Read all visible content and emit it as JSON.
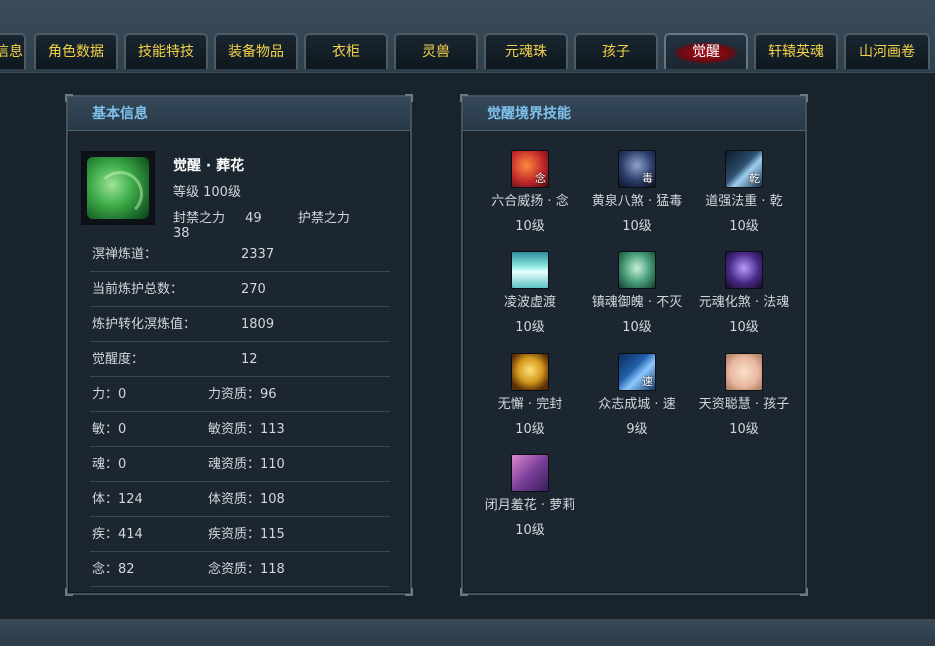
{
  "tabs": [
    {
      "label": "信息",
      "active": false
    },
    {
      "label": "角色数据",
      "active": false
    },
    {
      "label": "技能特技",
      "active": false
    },
    {
      "label": "装备物品",
      "active": false
    },
    {
      "label": "衣柜",
      "active": false
    },
    {
      "label": "灵兽",
      "active": false
    },
    {
      "label": "元魂珠",
      "active": false
    },
    {
      "label": "孩子",
      "active": false
    },
    {
      "label": "觉醒",
      "active": true
    },
    {
      "label": "轩辕英魂",
      "active": false
    },
    {
      "label": "山河画卷",
      "active": false
    }
  ],
  "basic_info": {
    "title": "基本信息",
    "name": "觉醒 · 葬花",
    "level": "等级 100级",
    "seal_label": "封禁之力",
    "seal_value": "49",
    "guard_label": "护禁之力",
    "guard_value": "38",
    "rows": [
      {
        "label": "溟禅炼道：",
        "value": "2337"
      },
      {
        "label": "当前炼护总数：",
        "value": "270"
      },
      {
        "label": "炼护转化溟炼值：",
        "value": "1809"
      },
      {
        "label": "觉醒度：",
        "value": "12"
      }
    ],
    "attrs": [
      {
        "label": "力：0",
        "qual": "力资质：96"
      },
      {
        "label": "敏：0",
        "qual": "敏资质：113"
      },
      {
        "label": "魂：0",
        "qual": "魂资质：110"
      },
      {
        "label": "体：124",
        "qual": "体资质：108"
      },
      {
        "label": "疾：414",
        "qual": "疾资质：115"
      },
      {
        "label": "念：82",
        "qual": "念资质：118"
      }
    ]
  },
  "skills_panel": {
    "title": "觉醒境界技能",
    "skills": [
      {
        "name": "六合威扬 · 念",
        "level": "10级",
        "icon": "fire-nian-icon",
        "glyph": "念",
        "color": "#c0282a"
      },
      {
        "name": "黄泉八煞 · 猛毒",
        "level": "10级",
        "icon": "skull-poison-icon",
        "glyph": "毒",
        "color": "#2c3c6a"
      },
      {
        "name": "道强法重 · 乾",
        "level": "10级",
        "icon": "blade-qian-icon",
        "glyph": "乾",
        "color": "#2d4f70"
      },
      {
        "name": "凌波虚渡",
        "level": "10级",
        "icon": "water-wave-icon",
        "glyph": "",
        "color": "#6fd3d0"
      },
      {
        "name": "镇魂御魄 · 不灭",
        "level": "10级",
        "icon": "ghost-face-icon",
        "glyph": "",
        "color": "#2f7a60"
      },
      {
        "name": "元魂化煞 · 法魂",
        "level": "10级",
        "icon": "demon-mask-icon",
        "glyph": "",
        "color": "#4a2a86"
      },
      {
        "name": "无懈 · 完封",
        "level": "10级",
        "icon": "golden-shield-icon",
        "glyph": "",
        "color": "#b07a18"
      },
      {
        "name": "众志成城 · 速",
        "level": "9级",
        "icon": "swift-warrior-icon",
        "glyph": "速",
        "color": "#1f5fa8"
      },
      {
        "name": "天资聪慧 · 孩子",
        "level": "10级",
        "icon": "baby-face-icon",
        "glyph": "",
        "color": "#e8b9a0"
      },
      {
        "name": "闭月羞花 · 萝莉",
        "level": "10级",
        "icon": "girl-portrait-icon",
        "glyph": "",
        "color": "#7a3f9a"
      }
    ]
  }
}
